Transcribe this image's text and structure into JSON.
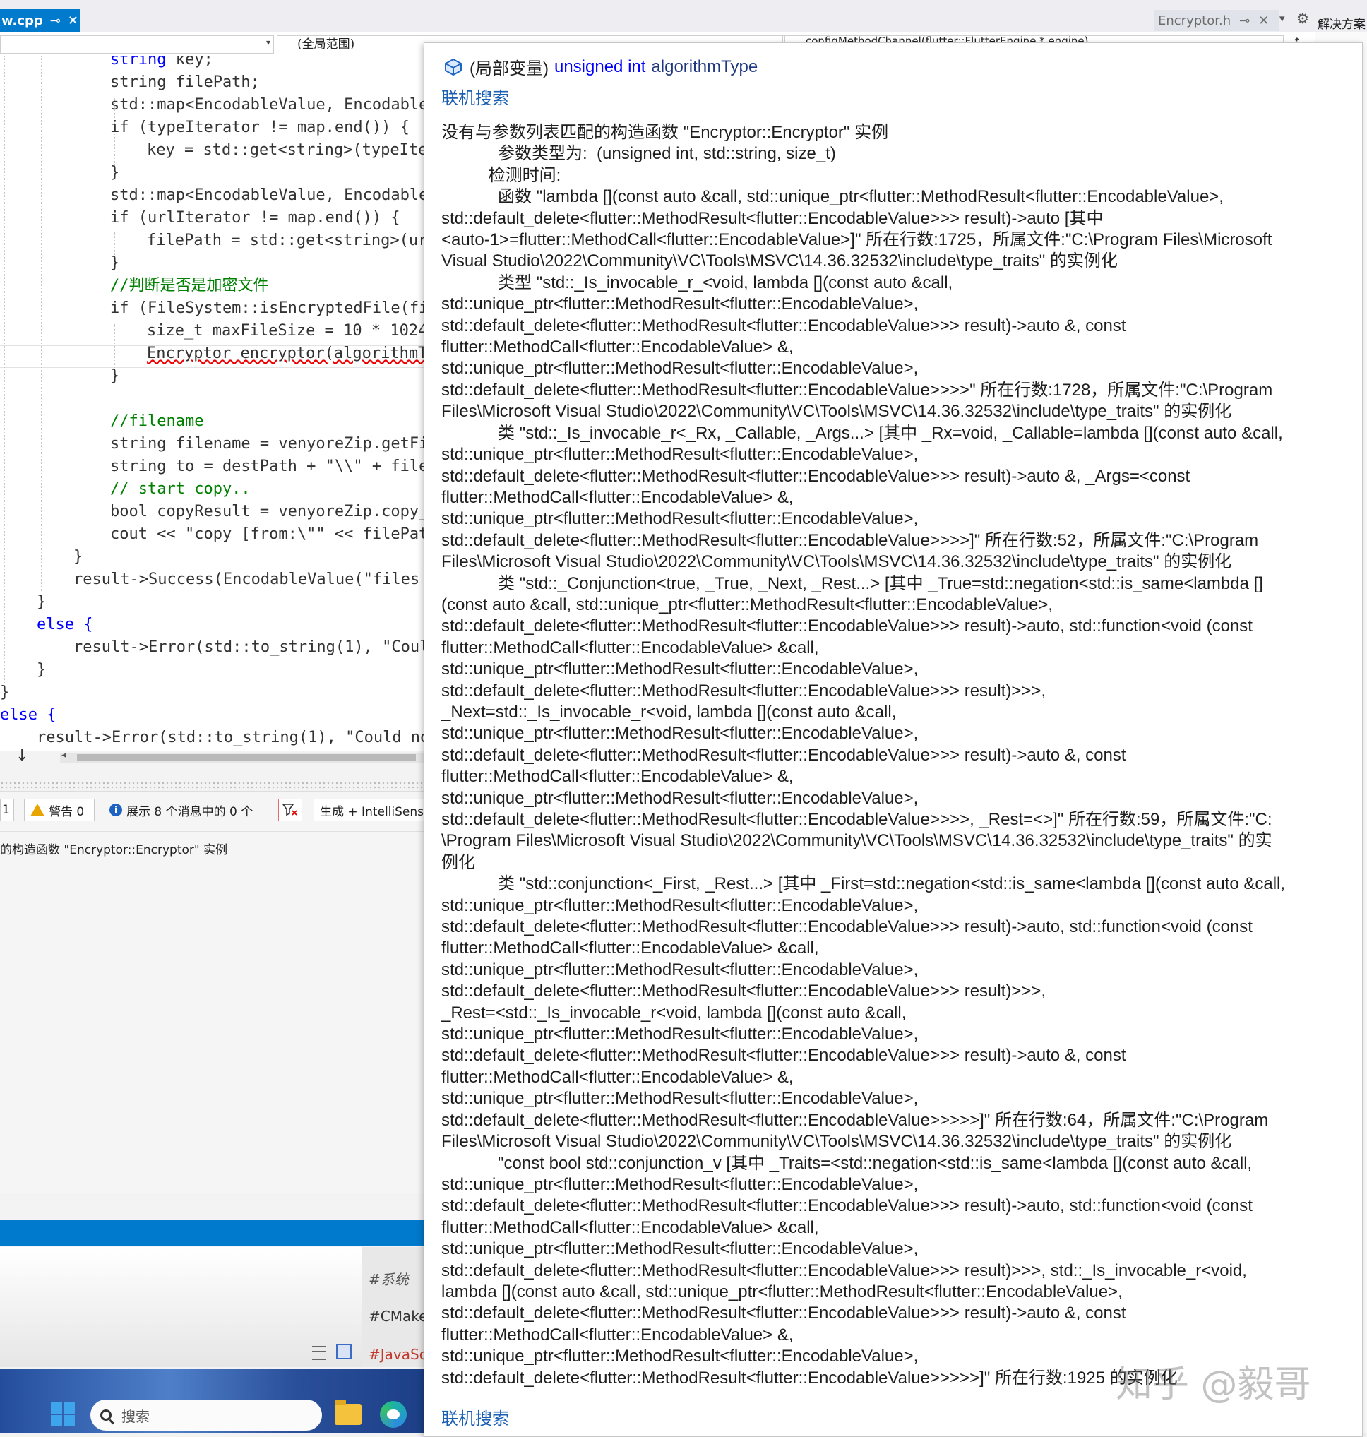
{
  "tabs": {
    "active": {
      "name": "w.cpp",
      "pin": "⊸",
      "close": "✕"
    },
    "right": {
      "name": "Encryptor.h",
      "pin": "⊸",
      "close": "✕"
    },
    "menu_icon": "chevron-down-icon",
    "gear": "⚙",
    "solution_label": "解决方案"
  },
  "navbar": {
    "scope": "(全局范围)",
    "member": "configMethodChannel(flutter::FlutterEngine * engine)"
  },
  "code_lines": [
    "string key;",
    "string filePath;",
    "std::map<EncodableValue, Encodable",
    "if (typeIterator != map.end()) {",
    "key = std::get<string>(typeIte",
    "}",
    "std::map<EncodableValue, Encodable",
    "if (urlIterator != map.end()) {",
    "filePath = std::get<string>(ur",
    "}",
    "//判断是否是加密文件",
    "if (FileSystem::isEncryptedFile(fi",
    "size_t maxFileSize = 10 * 1024",
    "Encryptor encryptor(algorithmT",
    "}",
    "",
    "//filename",
    "string filename = venyoreZip.getFi",
    "string to = destPath + \"\\\\\" + file",
    "// start copy..",
    "bool copyResult = venyoreZip.copy_",
    "cout << \"copy [from:\\\"\" << filePat",
    "}",
    "result->Success(EncodableValue(\"files",
    "}",
    "else {",
    "result->Error(std::to_string(1), \"Coul",
    "}",
    "}",
    "else {",
    "result->Error(std::to_string(1), \"Could no"
  ],
  "error_list": {
    "error_count": "1",
    "warnings": "警告 0",
    "messages": "展示 8 个消息中的 0 个",
    "build_filter": "生成 + IntelliSense",
    "first_row": "的构造函数 \"Encryptor::Encryptor\" 实例"
  },
  "lower_panel": {
    "tags": [
      "#系统",
      "#CMake",
      "#JavaSc"
    ]
  },
  "taskbar": {
    "search_placeholder": "搜索"
  },
  "tooltip": {
    "kind": "(局部变量)",
    "type": "unsigned int",
    "variable": "algorithmType",
    "online_search": "联机搜索",
    "lines": [
      "没有与参数列表匹配的构造函数 \"Encryptor::Encryptor\" 实例",
      "            参数类型为:  (unsigned int, std::string, size_t)",
      "          检测时间:",
      "            函数 \"lambda [](const auto &call, std::unique_ptr<flutter::MethodResult<flutter::EncodableValue>,",
      "std::default_delete<flutter::MethodResult<flutter::EncodableValue>>> result)->auto [其中",
      "<auto-1>=flutter::MethodCall<flutter::EncodableValue>]\" 所在行数:1725，所属文件:\"C:\\Program Files\\Microsoft",
      "Visual Studio\\2022\\Community\\VC\\Tools\\MSVC\\14.36.32532\\include\\type_traits\" 的实例化",
      "            类型 \"std::_Is_invocable_r_<void, lambda [](const auto &call,",
      "std::unique_ptr<flutter::MethodResult<flutter::EncodableValue>,",
      "std::default_delete<flutter::MethodResult<flutter::EncodableValue>>> result)->auto &, const",
      "flutter::MethodCall<flutter::EncodableValue> &,",
      "std::unique_ptr<flutter::MethodResult<flutter::EncodableValue>,",
      "std::default_delete<flutter::MethodResult<flutter::EncodableValue>>>>\" 所在行数:1728，所属文件:\"C:\\Program",
      "Files\\Microsoft Visual Studio\\2022\\Community\\VC\\Tools\\MSVC\\14.36.32532\\include\\type_traits\" 的实例化",
      "            类 \"std::_Is_invocable_r<_Rx, _Callable, _Args...> [其中 _Rx=void, _Callable=lambda [](const auto &call,",
      "std::unique_ptr<flutter::MethodResult<flutter::EncodableValue>,",
      "std::default_delete<flutter::MethodResult<flutter::EncodableValue>>> result)->auto &, _Args=<const",
      "flutter::MethodCall<flutter::EncodableValue> &,",
      "std::unique_ptr<flutter::MethodResult<flutter::EncodableValue>,",
      "std::default_delete<flutter::MethodResult<flutter::EncodableValue>>>>]\" 所在行数:52，所属文件:\"C:\\Program",
      "Files\\Microsoft Visual Studio\\2022\\Community\\VC\\Tools\\MSVC\\14.36.32532\\include\\type_traits\" 的实例化",
      "            类 \"std::_Conjunction<true, _True, _Next, _Rest...> [其中 _True=std::negation<std::is_same<lambda []",
      "(const auto &call, std::unique_ptr<flutter::MethodResult<flutter::EncodableValue>,",
      "std::default_delete<flutter::MethodResult<flutter::EncodableValue>>> result)->auto, std::function<void (const",
      "flutter::MethodCall<flutter::EncodableValue> &call,",
      "std::unique_ptr<flutter::MethodResult<flutter::EncodableValue>,",
      "std::default_delete<flutter::MethodResult<flutter::EncodableValue>>> result)>>>,",
      "_Next=std::_Is_invocable_r<void, lambda [](const auto &call,",
      "std::unique_ptr<flutter::MethodResult<flutter::EncodableValue>,",
      "std::default_delete<flutter::MethodResult<flutter::EncodableValue>>> result)->auto &, const",
      "flutter::MethodCall<flutter::EncodableValue> &,",
      "std::unique_ptr<flutter::MethodResult<flutter::EncodableValue>,",
      "std::default_delete<flutter::MethodResult<flutter::EncodableValue>>>>, _Rest=<>]\" 所在行数:59，所属文件:\"C:",
      "\\Program Files\\Microsoft Visual Studio\\2022\\Community\\VC\\Tools\\MSVC\\14.36.32532\\include\\type_traits\" 的实",
      "例化",
      "            类 \"std::conjunction<_First, _Rest...> [其中 _First=std::negation<std::is_same<lambda [](const auto &call,",
      "std::unique_ptr<flutter::MethodResult<flutter::EncodableValue>,",
      "std::default_delete<flutter::MethodResult<flutter::EncodableValue>>> result)->auto, std::function<void (const",
      "flutter::MethodCall<flutter::EncodableValue> &call,",
      "std::unique_ptr<flutter::MethodResult<flutter::EncodableValue>,",
      "std::default_delete<flutter::MethodResult<flutter::EncodableValue>>> result)>>>,",
      "_Rest=<std::_Is_invocable_r<void, lambda [](const auto &call,",
      "std::unique_ptr<flutter::MethodResult<flutter::EncodableValue>,",
      "std::default_delete<flutter::MethodResult<flutter::EncodableValue>>> result)->auto &, const",
      "flutter::MethodCall<flutter::EncodableValue> &,",
      "std::unique_ptr<flutter::MethodResult<flutter::EncodableValue>,",
      "std::default_delete<flutter::MethodResult<flutter::EncodableValue>>>>>]\" 所在行数:64，所属文件:\"C:\\Program",
      "Files\\Microsoft Visual Studio\\2022\\Community\\VC\\Tools\\MSVC\\14.36.32532\\include\\type_traits\" 的实例化",
      "            \"const bool std::conjunction_v [其中 _Traits=<std::negation<std::is_same<lambda [](const auto &call,",
      "std::unique_ptr<flutter::MethodResult<flutter::EncodableValue>,",
      "std::default_delete<flutter::MethodResult<flutter::EncodableValue>>> result)->auto, std::function<void (const",
      "flutter::MethodCall<flutter::EncodableValue> &call,",
      "std::unique_ptr<flutter::MethodResult<flutter::EncodableValue>,",
      "std::default_delete<flutter::MethodResult<flutter::EncodableValue>>> result)>>>, std::_Is_invocable_r<void,",
      "lambda [](const auto &call, std::unique_ptr<flutter::MethodResult<flutter::EncodableValue>,",
      "std::default_delete<flutter::MethodResult<flutter::EncodableValue>>> result)->auto &, const",
      "flutter::MethodCall<flutter::EncodableValue> &,",
      "std::unique_ptr<flutter::MethodResult<flutter::EncodableValue>,",
      "std::default_delete<flutter::MethodResult<flutter::EncodableValue>>>>>]\" 所在行数:1925 的实例化"
    ]
  },
  "watermark": "知乎 @毅哥",
  "colors": {
    "accent": "#007acc",
    "keyword": "#0000ff",
    "type": "#2b91af",
    "comment": "#008000",
    "string": "#a31515",
    "link": "#1a5fb4"
  }
}
